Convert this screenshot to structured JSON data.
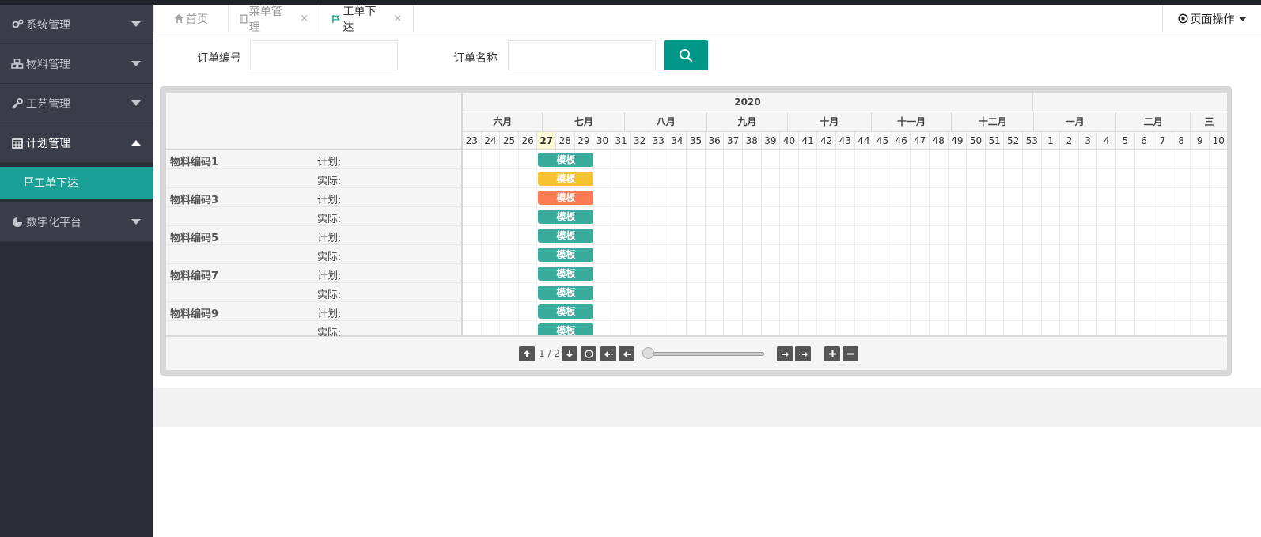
{
  "sidebar": {
    "items": [
      {
        "label": "系统管理",
        "icon": "gears-icon"
      },
      {
        "label": "物料管理",
        "icon": "cubes-icon"
      },
      {
        "label": "工艺管理",
        "icon": "wrench-icon"
      },
      {
        "label": "计划管理",
        "icon": "calendar-icon"
      },
      {
        "label": "数字化平台",
        "icon": "pie-chart-icon"
      }
    ],
    "sub_item": {
      "label": "工单下达",
      "icon": "flag-icon"
    }
  },
  "tabs": [
    {
      "label": "首页",
      "icon": "home-icon"
    },
    {
      "label": "菜单管理",
      "icon": "book-icon",
      "close": "×"
    },
    {
      "label": "工单下达",
      "icon": "flag-icon",
      "close": "×"
    }
  ],
  "page_ops": {
    "label": "页面操作"
  },
  "search": {
    "order_no_label": "订单编号",
    "order_name_label": "订单名称",
    "order_no_value": "",
    "order_name_value": ""
  },
  "gantt": {
    "year": "2020",
    "months": [
      "六月",
      "七月",
      "八月",
      "九月",
      "十月",
      "十一月",
      "十二月",
      "一月",
      "二月",
      "三"
    ],
    "weeks": [
      "23",
      "24",
      "25",
      "26",
      "27",
      "28",
      "29",
      "30",
      "31",
      "32",
      "33",
      "34",
      "35",
      "36",
      "37",
      "38",
      "39",
      "40",
      "41",
      "42",
      "43",
      "44",
      "45",
      "46",
      "47",
      "48",
      "49",
      "50",
      "51",
      "52",
      "53",
      "1",
      "2",
      "3",
      "4",
      "5",
      "6",
      "7",
      "8",
      "9",
      "10"
    ],
    "today_week": "27",
    "rows": [
      {
        "name": "物料编码1",
        "type": "计划:",
        "bar": "模板",
        "color": "#38ab9a"
      },
      {
        "name": "",
        "type": "实际:",
        "bar": "模板",
        "color": "#f8c132"
      },
      {
        "name": "物料编码3",
        "type": "计划:",
        "bar": "模板",
        "color": "#fc7b50"
      },
      {
        "name": "",
        "type": "实际:",
        "bar": "模板",
        "color": "#38ab9a"
      },
      {
        "name": "物料编码5",
        "type": "计划:",
        "bar": "模板",
        "color": "#38ab9a"
      },
      {
        "name": "",
        "type": "实际:",
        "bar": "模板",
        "color": "#38ab9a"
      },
      {
        "name": "物料编码7",
        "type": "计划:",
        "bar": "模板",
        "color": "#38ab9a"
      },
      {
        "name": "",
        "type": "实际:",
        "bar": "模板",
        "color": "#38ab9a"
      },
      {
        "name": "物料编码9",
        "type": "计划:",
        "bar": "模板",
        "color": "#38ab9a"
      },
      {
        "name": "",
        "type": "实际:",
        "bar": "模板",
        "color": "#38ab9a"
      }
    ],
    "pager": "1 / 2"
  }
}
